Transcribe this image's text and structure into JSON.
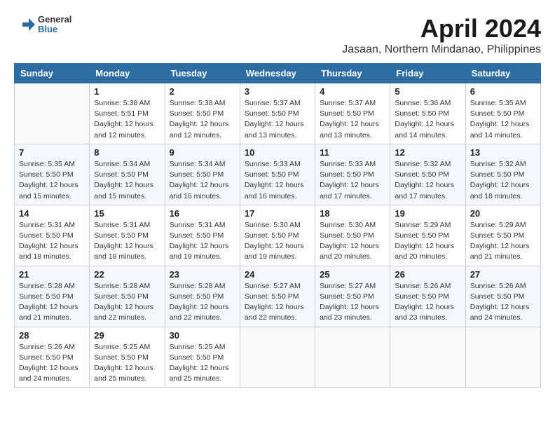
{
  "header": {
    "logo_line1": "General",
    "logo_line2": "Blue",
    "month": "April 2024",
    "location": "Jasaan, Northern Mindanao, Philippines"
  },
  "weekdays": [
    "Sunday",
    "Monday",
    "Tuesday",
    "Wednesday",
    "Thursday",
    "Friday",
    "Saturday"
  ],
  "weeks": [
    [
      {
        "day": "",
        "info": ""
      },
      {
        "day": "1",
        "info": "Sunrise: 5:38 AM\nSunset: 5:51 PM\nDaylight: 12 hours\nand 12 minutes."
      },
      {
        "day": "2",
        "info": "Sunrise: 5:38 AM\nSunset: 5:50 PM\nDaylight: 12 hours\nand 12 minutes."
      },
      {
        "day": "3",
        "info": "Sunrise: 5:37 AM\nSunset: 5:50 PM\nDaylight: 12 hours\nand 13 minutes."
      },
      {
        "day": "4",
        "info": "Sunrise: 5:37 AM\nSunset: 5:50 PM\nDaylight: 12 hours\nand 13 minutes."
      },
      {
        "day": "5",
        "info": "Sunrise: 5:36 AM\nSunset: 5:50 PM\nDaylight: 12 hours\nand 14 minutes."
      },
      {
        "day": "6",
        "info": "Sunrise: 5:35 AM\nSunset: 5:50 PM\nDaylight: 12 hours\nand 14 minutes."
      }
    ],
    [
      {
        "day": "7",
        "info": "Sunrise: 5:35 AM\nSunset: 5:50 PM\nDaylight: 12 hours\nand 15 minutes."
      },
      {
        "day": "8",
        "info": "Sunrise: 5:34 AM\nSunset: 5:50 PM\nDaylight: 12 hours\nand 15 minutes."
      },
      {
        "day": "9",
        "info": "Sunrise: 5:34 AM\nSunset: 5:50 PM\nDaylight: 12 hours\nand 16 minutes."
      },
      {
        "day": "10",
        "info": "Sunrise: 5:33 AM\nSunset: 5:50 PM\nDaylight: 12 hours\nand 16 minutes."
      },
      {
        "day": "11",
        "info": "Sunrise: 5:33 AM\nSunset: 5:50 PM\nDaylight: 12 hours\nand 17 minutes."
      },
      {
        "day": "12",
        "info": "Sunrise: 5:32 AM\nSunset: 5:50 PM\nDaylight: 12 hours\nand 17 minutes."
      },
      {
        "day": "13",
        "info": "Sunrise: 5:32 AM\nSunset: 5:50 PM\nDaylight: 12 hours\nand 18 minutes."
      }
    ],
    [
      {
        "day": "14",
        "info": "Sunrise: 5:31 AM\nSunset: 5:50 PM\nDaylight: 12 hours\nand 18 minutes."
      },
      {
        "day": "15",
        "info": "Sunrise: 5:31 AM\nSunset: 5:50 PM\nDaylight: 12 hours\nand 18 minutes."
      },
      {
        "day": "16",
        "info": "Sunrise: 5:31 AM\nSunset: 5:50 PM\nDaylight: 12 hours\nand 19 minutes."
      },
      {
        "day": "17",
        "info": "Sunrise: 5:30 AM\nSunset: 5:50 PM\nDaylight: 12 hours\nand 19 minutes."
      },
      {
        "day": "18",
        "info": "Sunrise: 5:30 AM\nSunset: 5:50 PM\nDaylight: 12 hours\nand 20 minutes."
      },
      {
        "day": "19",
        "info": "Sunrise: 5:29 AM\nSunset: 5:50 PM\nDaylight: 12 hours\nand 20 minutes."
      },
      {
        "day": "20",
        "info": "Sunrise: 5:29 AM\nSunset: 5:50 PM\nDaylight: 12 hours\nand 21 minutes."
      }
    ],
    [
      {
        "day": "21",
        "info": "Sunrise: 5:28 AM\nSunset: 5:50 PM\nDaylight: 12 hours\nand 21 minutes."
      },
      {
        "day": "22",
        "info": "Sunrise: 5:28 AM\nSunset: 5:50 PM\nDaylight: 12 hours\nand 22 minutes."
      },
      {
        "day": "23",
        "info": "Sunrise: 5:28 AM\nSunset: 5:50 PM\nDaylight: 12 hours\nand 22 minutes."
      },
      {
        "day": "24",
        "info": "Sunrise: 5:27 AM\nSunset: 5:50 PM\nDaylight: 12 hours\nand 22 minutes."
      },
      {
        "day": "25",
        "info": "Sunrise: 5:27 AM\nSunset: 5:50 PM\nDaylight: 12 hours\nand 23 minutes."
      },
      {
        "day": "26",
        "info": "Sunrise: 5:26 AM\nSunset: 5:50 PM\nDaylight: 12 hours\nand 23 minutes."
      },
      {
        "day": "27",
        "info": "Sunrise: 5:26 AM\nSunset: 5:50 PM\nDaylight: 12 hours\nand 24 minutes."
      }
    ],
    [
      {
        "day": "28",
        "info": "Sunrise: 5:26 AM\nSunset: 5:50 PM\nDaylight: 12 hours\nand 24 minutes."
      },
      {
        "day": "29",
        "info": "Sunrise: 5:25 AM\nSunset: 5:50 PM\nDaylight: 12 hours\nand 25 minutes."
      },
      {
        "day": "30",
        "info": "Sunrise: 5:25 AM\nSunset: 5:50 PM\nDaylight: 12 hours\nand 25 minutes."
      },
      {
        "day": "",
        "info": ""
      },
      {
        "day": "",
        "info": ""
      },
      {
        "day": "",
        "info": ""
      },
      {
        "day": "",
        "info": ""
      }
    ]
  ]
}
